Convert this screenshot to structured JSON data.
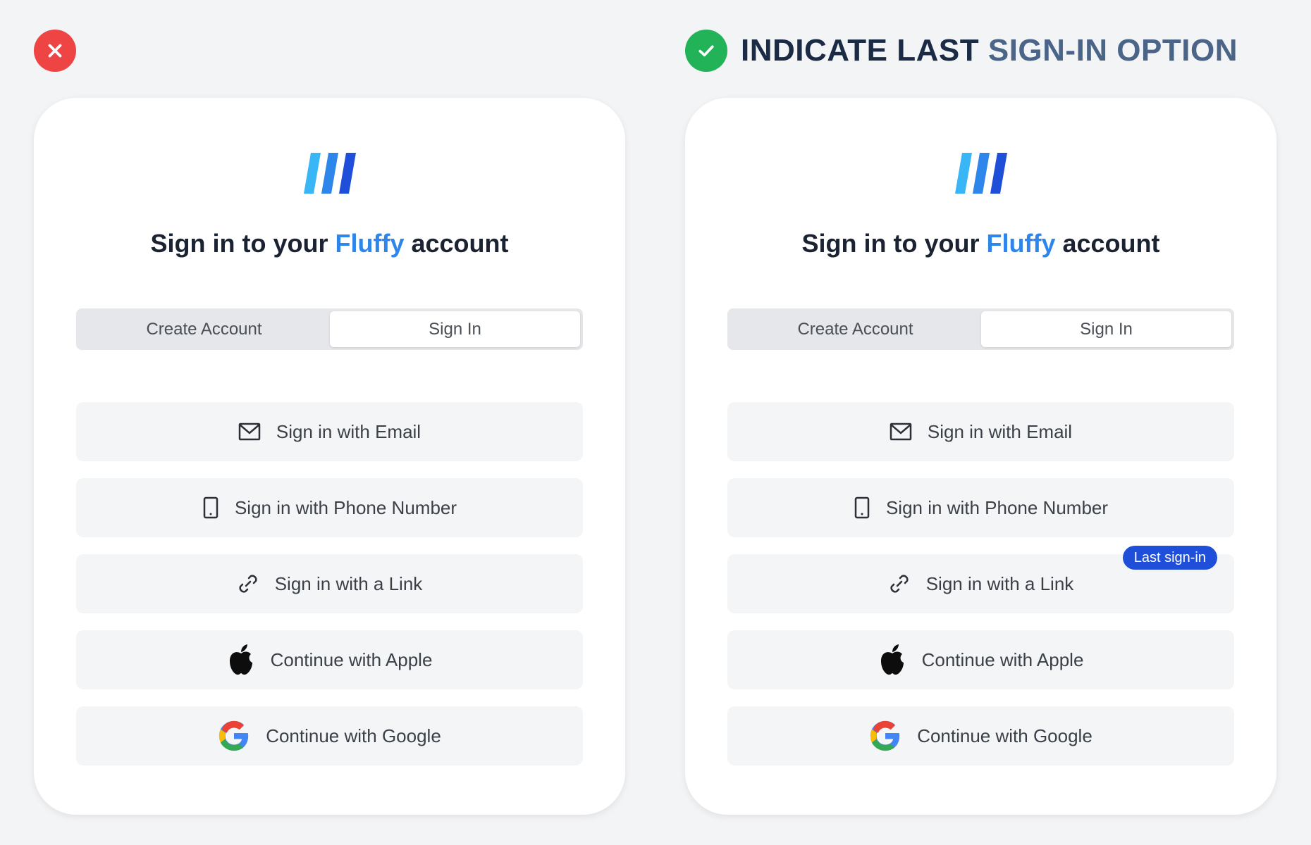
{
  "colors": {
    "error": "#ef4444",
    "success": "#22b257",
    "brand": "#2f86ea",
    "badge": "#1f4fd8"
  },
  "headline": {
    "part1": "INDICATE LAST ",
    "part2": "SIGN-IN OPTION"
  },
  "cards": [
    {
      "status": "incorrect",
      "title_pre": "Sign in to your ",
      "title_brand": "Fluffy",
      "title_post": " account",
      "tabs": {
        "create": "Create Account",
        "signin": "Sign In",
        "active": "signin"
      },
      "options": [
        {
          "label": "Sign in with Email",
          "icon": "mail-icon"
        },
        {
          "label": "Sign in with Phone Number",
          "icon": "phone-icon"
        },
        {
          "label": "Sign in with a Link",
          "icon": "link-icon"
        },
        {
          "label": "Continue with Apple",
          "icon": "apple-icon"
        },
        {
          "label": "Continue with Google",
          "icon": "google-icon"
        }
      ]
    },
    {
      "status": "correct",
      "title_pre": "Sign in to your ",
      "title_brand": "Fluffy",
      "title_post": " account",
      "tabs": {
        "create": "Create Account",
        "signin": "Sign In",
        "active": "signin"
      },
      "options": [
        {
          "label": "Sign in with Email",
          "icon": "mail-icon"
        },
        {
          "label": "Sign in with Phone Number",
          "icon": "phone-icon"
        },
        {
          "label": "Sign in with a Link",
          "icon": "link-icon",
          "badge": "Last sign-in"
        },
        {
          "label": "Continue with Apple",
          "icon": "apple-icon"
        },
        {
          "label": "Continue with Google",
          "icon": "google-icon"
        }
      ]
    }
  ]
}
